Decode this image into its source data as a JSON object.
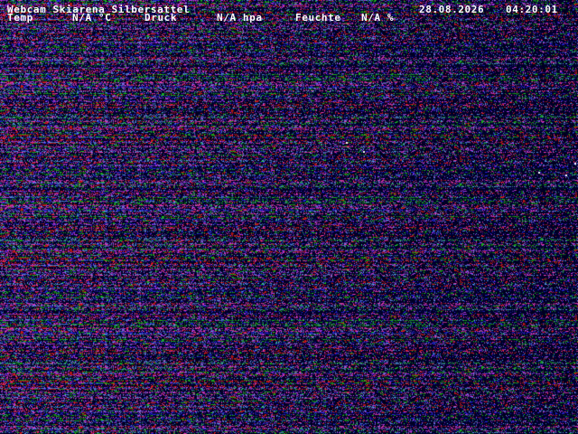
{
  "overlay": {
    "title": "Webcam Skiarena Silbersattel",
    "date": "28.08.2026",
    "time": "04:20:01",
    "temp_label": "Temp",
    "temp_value": "N/A °C",
    "pressure_label": "Druck",
    "pressure_value": "N/A hpa",
    "humidity_label": "Feuchte",
    "humidity_value": "N/A %"
  },
  "colors": {
    "background": "#00000a",
    "text": "#ffffff",
    "noise_palette": [
      "#ff2020",
      "#2a2aff",
      "#20d020",
      "#c040ff",
      "#ff40c0",
      "#60a0ff"
    ]
  }
}
